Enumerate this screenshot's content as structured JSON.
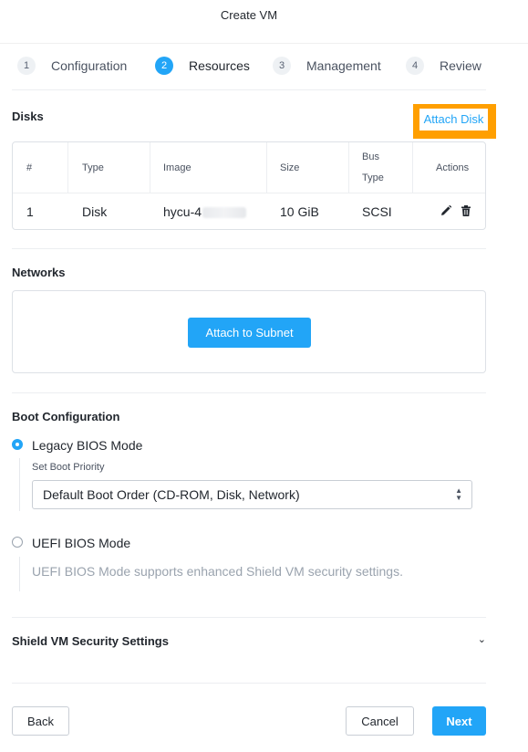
{
  "dialog": {
    "title": "Create VM"
  },
  "stepper": [
    {
      "num": "1",
      "label": "Configuration",
      "active": false
    },
    {
      "num": "2",
      "label": "Resources",
      "active": true
    },
    {
      "num": "3",
      "label": "Management",
      "active": false
    },
    {
      "num": "4",
      "label": "Review",
      "active": false
    }
  ],
  "disks": {
    "title": "Disks",
    "attach_label": "Attach Disk",
    "columns": [
      "#",
      "Type",
      "Image",
      "Size",
      "Bus",
      "Type",
      "Actions"
    ],
    "rows": [
      {
        "index": "1",
        "type": "Disk",
        "image": "hycu-4",
        "size": "10 GiB",
        "bus_type": "SCSI"
      }
    ],
    "actions": [
      "pencil-icon",
      "trash-icon"
    ]
  },
  "networks": {
    "title": "Networks",
    "attach_label": "Attach to Subnet"
  },
  "boot": {
    "title": "Boot Configuration",
    "legacy_label": "Legacy BIOS Mode",
    "priority_label": "Set Boot Priority",
    "priority_value": "Default Boot Order (CD-ROM, Disk, Network)",
    "uefi_label": "UEFI BIOS Mode",
    "uefi_note": "UEFI BIOS Mode supports enhanced Shield VM security settings.",
    "selected": "legacy"
  },
  "shield": {
    "title": "Shield VM Security Settings"
  },
  "footer": {
    "back": "Back",
    "cancel": "Cancel",
    "next": "Next"
  },
  "colors": {
    "accent": "#22a5f7",
    "highlight": "#ff9f00"
  }
}
